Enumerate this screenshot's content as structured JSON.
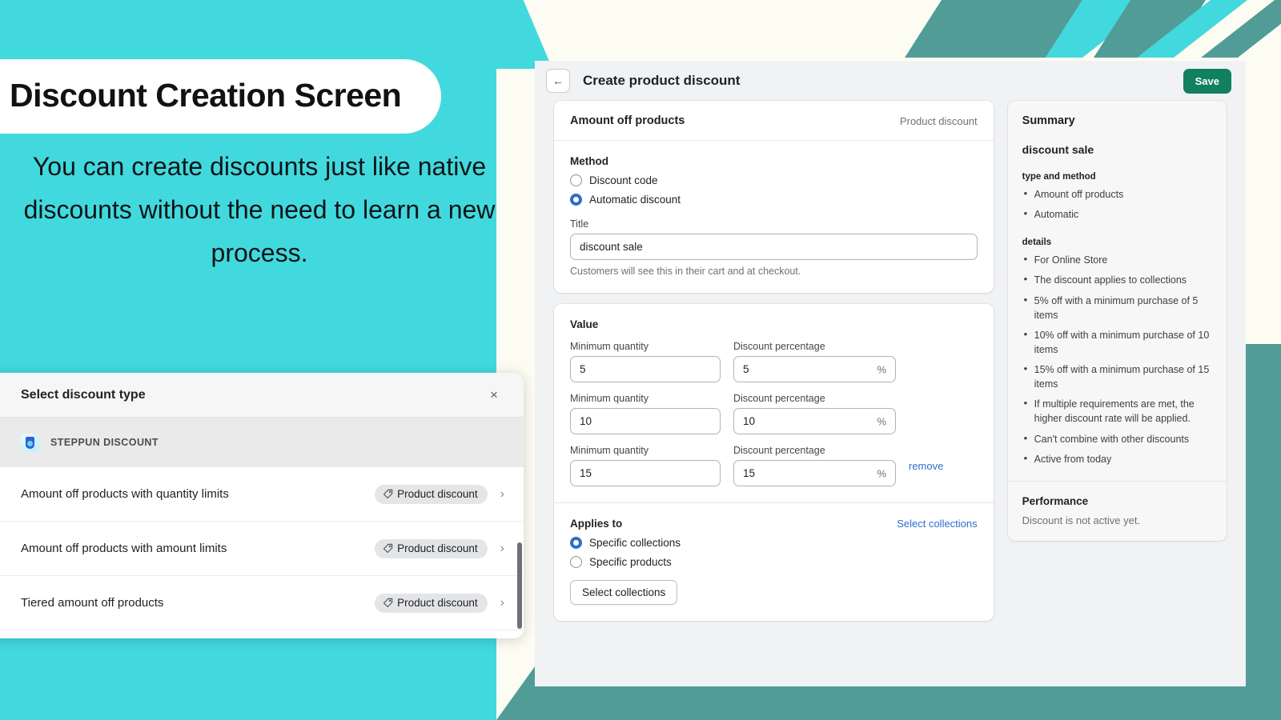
{
  "colors": {
    "cyan": "#41D9DE",
    "teal": "#519C96",
    "cream": "#FDFCF3",
    "save_green": "#108060",
    "link_blue": "#2C6ECB"
  },
  "marketing": {
    "headline": "Discount Creation Screen",
    "subcopy": "You can create discounts just like native discounts without the need to learn a new process."
  },
  "modal": {
    "title": "Select discount type",
    "close_label": "×",
    "app_group": "STEPPUN DISCOUNT",
    "rows": [
      {
        "label": "Amount off products with quantity limits",
        "badge": "Product discount",
        "chevron": "›"
      },
      {
        "label": "Amount off products with amount limits",
        "badge": "Product discount",
        "chevron": "›"
      },
      {
        "label": "Tiered amount off products",
        "badge": "Product discount",
        "chevron": "›"
      }
    ]
  },
  "admin": {
    "back_icon": "←",
    "title": "Create product discount",
    "save_label": "Save",
    "discount_card": {
      "title": "Amount off products",
      "meta": "Product discount",
      "method_label": "Method",
      "methods": [
        {
          "label": "Discount code",
          "selected": false
        },
        {
          "label": "Automatic discount",
          "selected": true
        }
      ],
      "title_field_label": "Title",
      "title_field_value": "discount sale",
      "title_field_placeholder": "Title",
      "title_help": "Customers will see this in their cart and at checkout."
    },
    "value_card": {
      "title": "Value",
      "qty_label": "Minimum quantity",
      "pct_label": "Discount percentage",
      "pct_suffix": "%",
      "remove_label": "remove",
      "tiers": [
        {
          "min_quantity": "5",
          "percentage": "5"
        },
        {
          "min_quantity": "10",
          "percentage": "10"
        },
        {
          "min_quantity": "15",
          "percentage": "15"
        }
      ]
    },
    "applies_card": {
      "title": "Applies to",
      "action_link": "Select collections",
      "options": [
        {
          "label": "Specific collections",
          "selected": true
        },
        {
          "label": "Specific products",
          "selected": false
        }
      ],
      "button_label": "Select collections"
    },
    "summary": {
      "title": "Summary",
      "discount_name": "discount sale",
      "group1_head": "type and method",
      "group1_items": [
        "Amount off products",
        "Automatic"
      ],
      "group2_head": "details",
      "group2_items": [
        "For Online Store",
        "The discount applies to collections",
        "5% off with a minimum purchase of 5 items",
        "10% off with a minimum purchase of 10 items",
        "15% off with a minimum purchase of 15 items",
        "If multiple requirements are met, the higher discount rate will be applied.",
        "Can't combine with other discounts",
        "Active from today"
      ],
      "performance_title": "Performance",
      "performance_text": "Discount is not active yet."
    }
  }
}
